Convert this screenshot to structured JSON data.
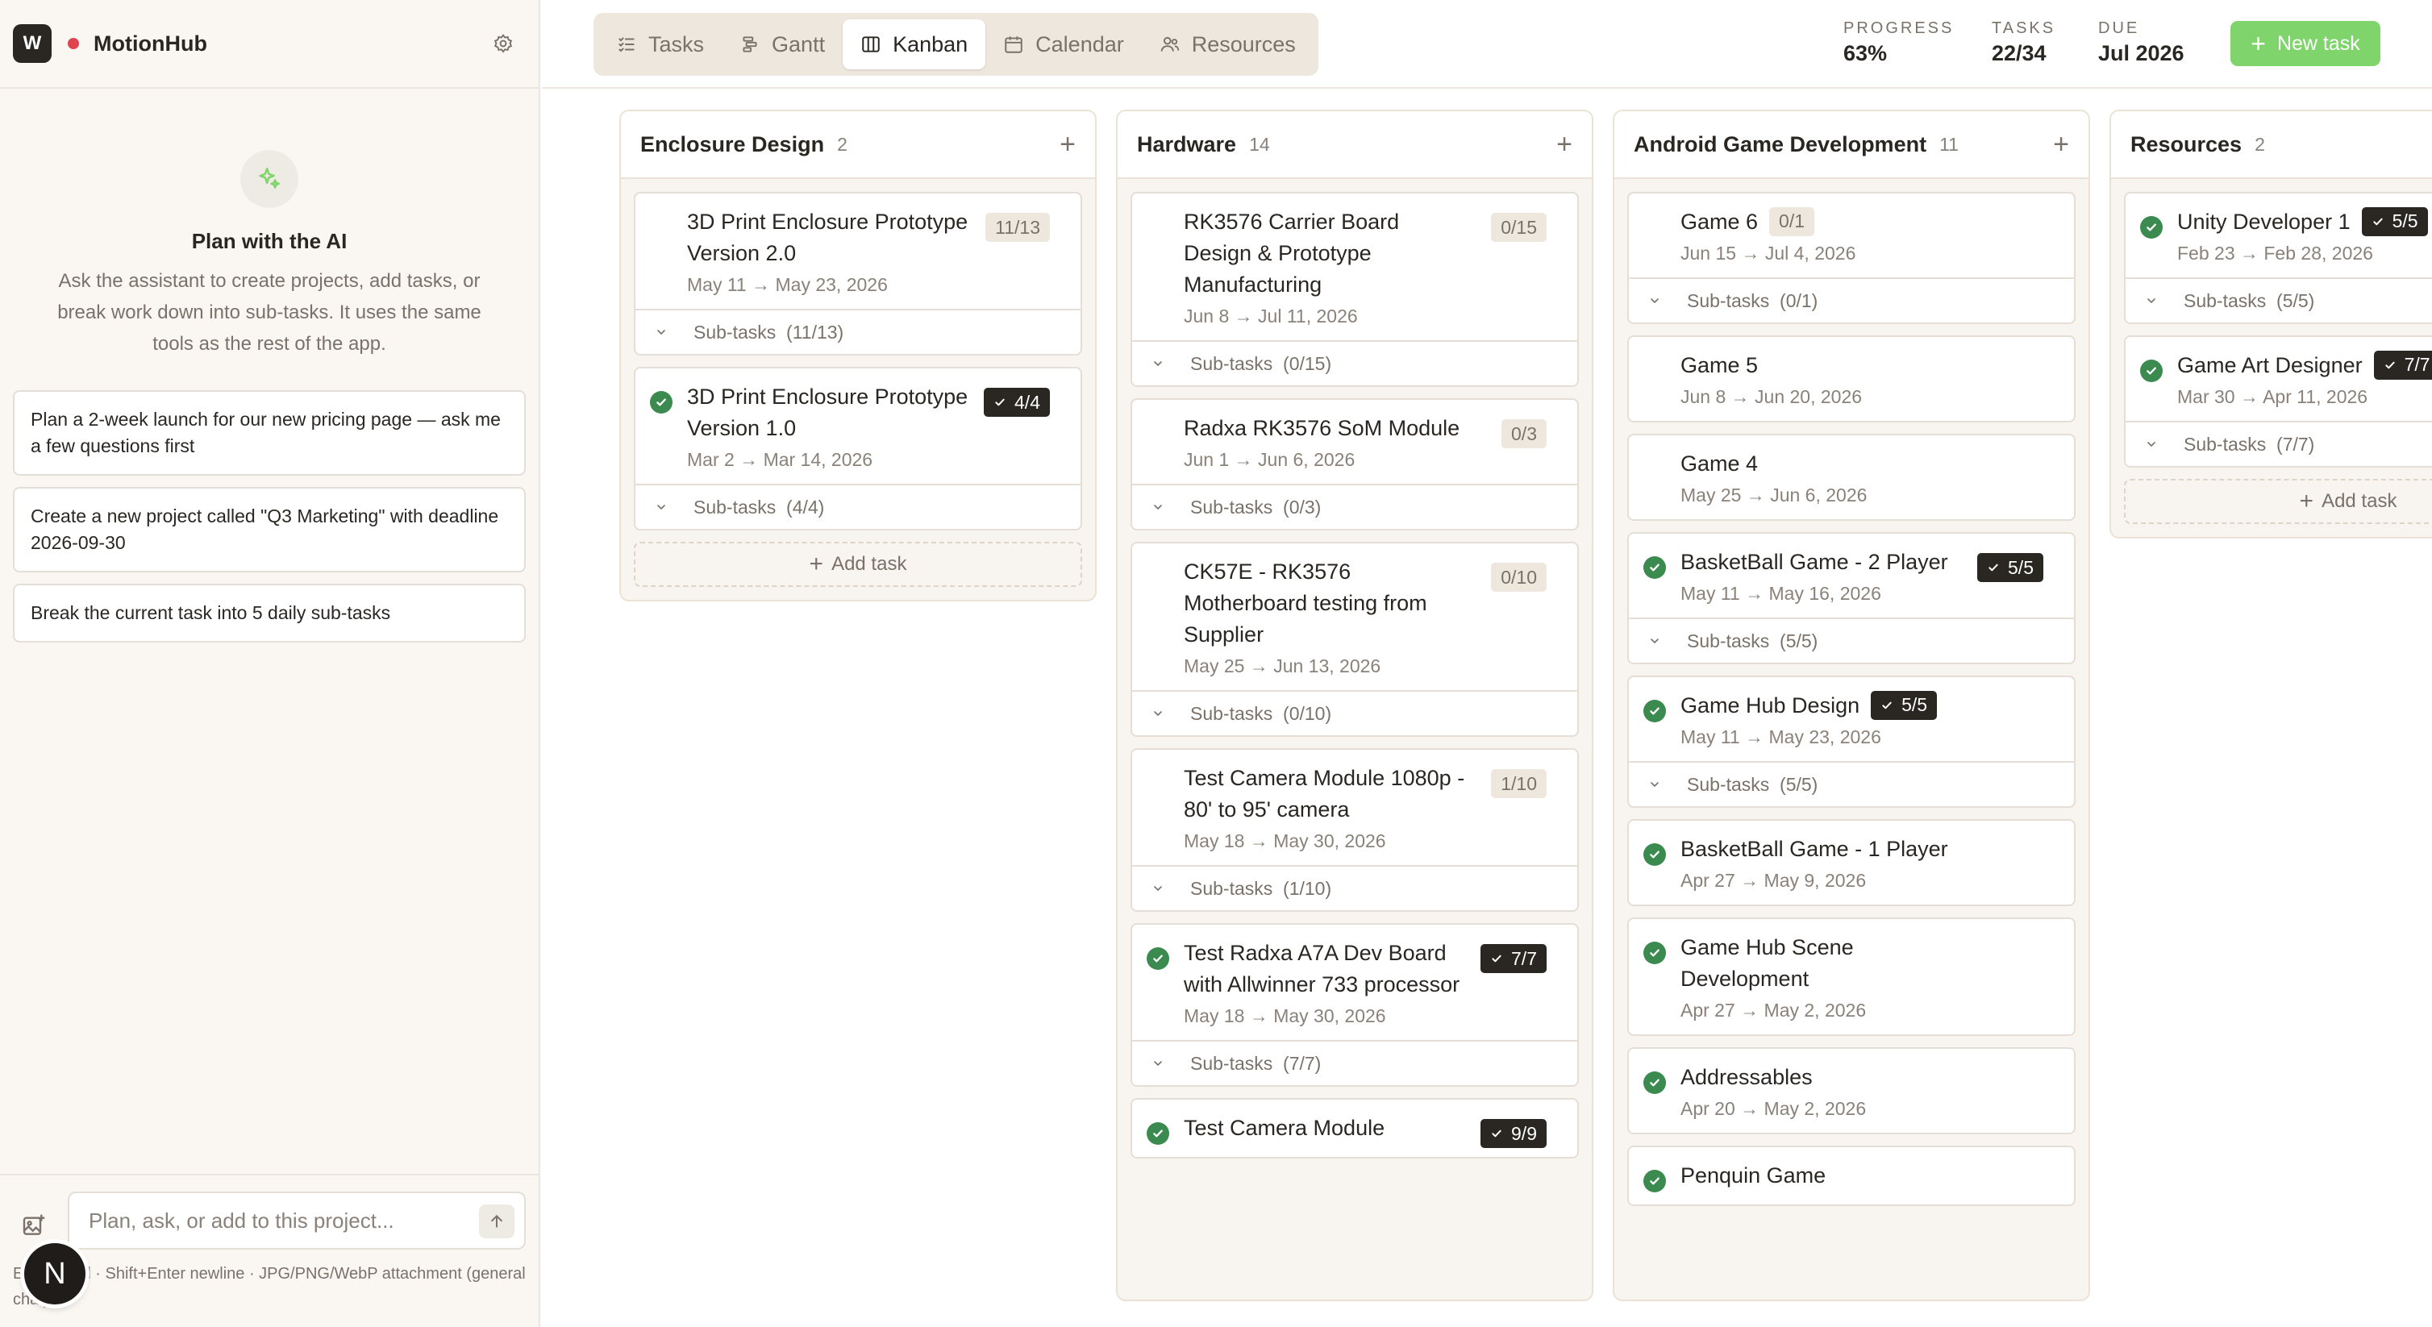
{
  "app": {
    "workspace_initial": "W",
    "name": "MotionHub"
  },
  "sidebar": {
    "ai_title": "Plan with the AI",
    "ai_description": "Ask the assistant to create projects, add tasks, or break work down into sub-tasks. It uses the same tools as the rest of the app.",
    "suggestions": [
      "Plan a 2-week launch for our new pricing page — ask me a few questions first",
      "Create a new project called \"Q3 Marketing\" with deadline 2026-09-30",
      "Break the current task into 5 daily sub-tasks"
    ],
    "chat_placeholder": "Plan, ask, or add to this project...",
    "hint": "Enter send · Shift+Enter newline · JPG/PNG/WebP attachment (general chat)",
    "avatar_initial": "N"
  },
  "tabs": [
    {
      "label": "Tasks",
      "icon": "list-icon"
    },
    {
      "label": "Gantt",
      "icon": "gantt-icon"
    },
    {
      "label": "Kanban",
      "icon": "kanban-icon",
      "active": true
    },
    {
      "label": "Calendar",
      "icon": "calendar-icon"
    },
    {
      "label": "Resources",
      "icon": "users-icon"
    }
  ],
  "stats": {
    "progress_label": "PROGRESS",
    "progress_value": "63%",
    "progress_fraction": 0.63,
    "tasks_label": "TASKS",
    "tasks_value": "22/34",
    "due_label": "DUE",
    "due_value": "Jul 2026"
  },
  "new_task_label": "New task",
  "add_task_label": "Add task",
  "colors": {
    "accent_green": "#7fd46b",
    "done_green": "#3b8a4f",
    "badge_dark": "#2a2622"
  },
  "columns": [
    {
      "title": "Enclosure Design",
      "count": "2",
      "add_task": true,
      "cards": [
        {
          "title": "3D Print Enclosure Prototype Version 2.0",
          "date": "May 11 → May 23, 2026",
          "badge": "11/13",
          "done": false,
          "subtasks": "Sub-tasks  (11/13)"
        },
        {
          "title": "3D Print Enclosure Prototype Version 1.0",
          "date": "Mar 2 → Mar 14, 2026",
          "badge": "4/4",
          "done": true,
          "subtasks": "Sub-tasks  (4/4)"
        }
      ]
    },
    {
      "title": "Hardware",
      "count": "14",
      "add_task": false,
      "cards": [
        {
          "title": "RK3576 Carrier Board Design & Prototype Manufacturing",
          "date": "Jun 8 → Jul 11, 2026",
          "badge": "0/15",
          "done": false,
          "subtasks": "Sub-tasks  (0/15)"
        },
        {
          "title": "Radxa RK3576 SoM Module",
          "date": "Jun 1 → Jun 6, 2026",
          "badge": "0/3",
          "done": false,
          "subtasks": "Sub-tasks  (0/3)"
        },
        {
          "title": "CK57E - RK3576 Motherboard testing from Supplier",
          "date": "May 25 → Jun 13, 2026",
          "badge": "0/10",
          "done": false,
          "subtasks": "Sub-tasks  (0/10)"
        },
        {
          "title": "Test Camera Module 1080p - 80' to 95' camera",
          "date": "May 18 → May 30, 2026",
          "badge": "1/10",
          "done": false,
          "subtasks": "Sub-tasks  (1/10)"
        },
        {
          "title": "Test Radxa A7A Dev Board with Allwinner 733 processor",
          "date": "May 18 → May 30, 2026",
          "badge": "7/7",
          "done": true,
          "subtasks": "Sub-tasks  (7/7)"
        },
        {
          "title": "Test Camera Module",
          "date": "",
          "badge": "9/9",
          "done": true,
          "subtasks": ""
        }
      ]
    },
    {
      "title": "Android Game Development",
      "count": "11",
      "add_task": false,
      "cards": [
        {
          "title": "Game 6",
          "date": "Jun 15 → Jul 4, 2026",
          "badge": "0/1",
          "done": false,
          "subtasks": "Sub-tasks  (0/1)",
          "inline_badge": true
        },
        {
          "title": "Game 5",
          "date": "Jun 8 → Jun 20, 2026",
          "badge": "",
          "done": false,
          "subtasks": ""
        },
        {
          "title": "Game 4",
          "date": "May 25 → Jun 6, 2026",
          "badge": "",
          "done": false,
          "subtasks": ""
        },
        {
          "title": "BasketBall Game - 2 Player",
          "date": "May 11 → May 16, 2026",
          "badge": "5/5",
          "done": true,
          "subtasks": "Sub-tasks  (5/5)"
        },
        {
          "title": "Game Hub Design",
          "date": "May 11 → May 23, 2026",
          "badge": "5/5",
          "done": true,
          "subtasks": "Sub-tasks  (5/5)",
          "inline_badge": true
        },
        {
          "title": "BasketBall Game - 1 Player",
          "date": "Apr 27 → May 9, 2026",
          "badge": "",
          "done": true,
          "subtasks": ""
        },
        {
          "title": "Game Hub Scene Development",
          "date": "Apr 27 → May 2, 2026",
          "badge": "",
          "done": true,
          "subtasks": ""
        },
        {
          "title": "Addressables",
          "date": "Apr 20 → May 2, 2026",
          "badge": "",
          "done": true,
          "subtasks": ""
        },
        {
          "title": "Penquin Game",
          "date": "",
          "badge": "",
          "done": true,
          "subtasks": ""
        }
      ]
    },
    {
      "title": "Resources",
      "count": "2",
      "add_task": true,
      "cards": [
        {
          "title": "Unity Developer 1",
          "date": "Feb 23 → Feb 28, 2026",
          "badge": "5/5",
          "done": true,
          "subtasks": "Sub-tasks  (5/5)",
          "inline_badge": true
        },
        {
          "title": "Game Art Designer",
          "date": "Mar 30 → Apr 11, 2026",
          "badge": "7/7",
          "done": true,
          "subtasks": "Sub-tasks  (7/7)",
          "inline_badge": true
        }
      ]
    }
  ]
}
